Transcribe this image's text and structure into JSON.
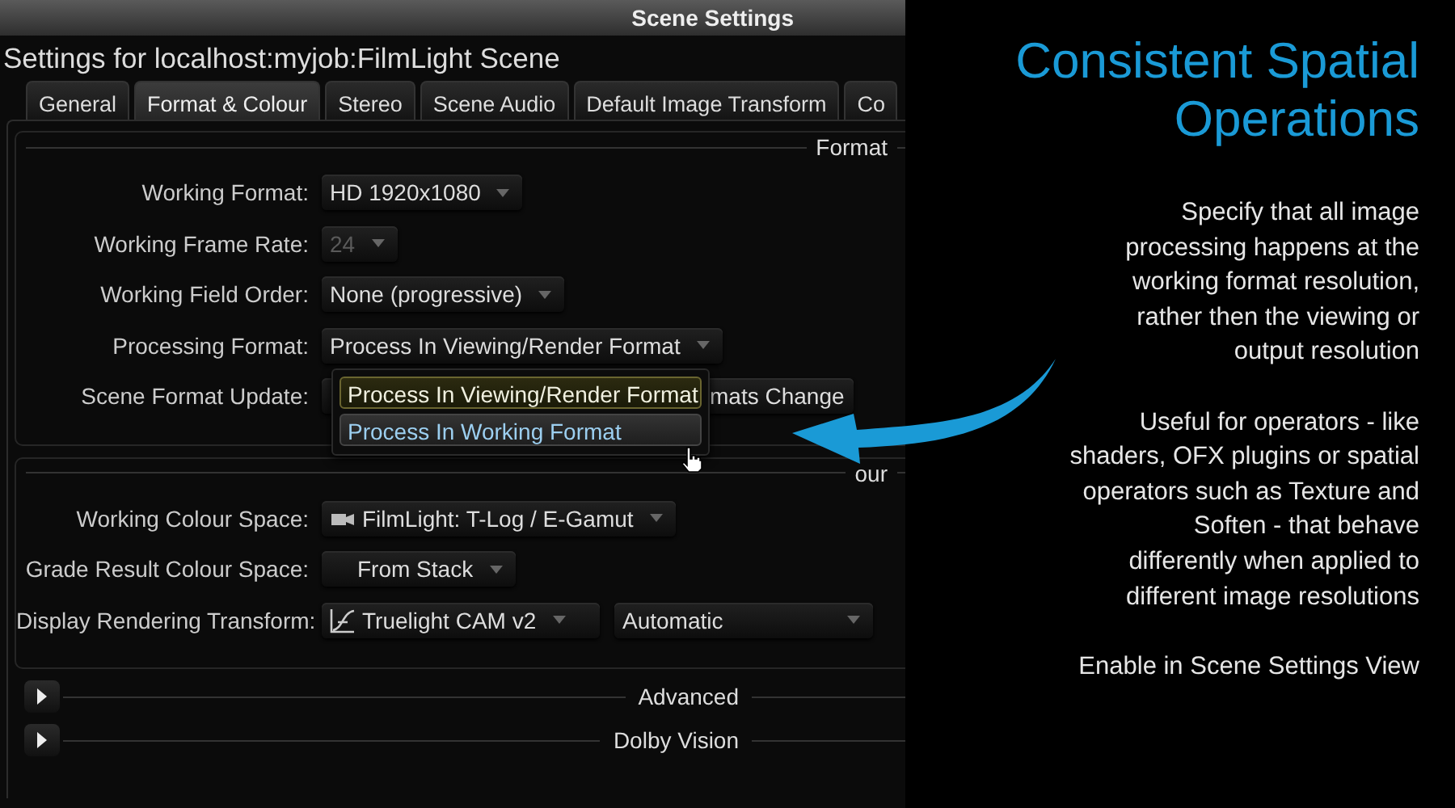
{
  "window": {
    "title": "Scene Settings"
  },
  "heading": "Settings for localhost:myjob:FilmLight Scene",
  "tabs": [
    {
      "label": "General",
      "selected": false
    },
    {
      "label": "Format & Colour",
      "selected": true
    },
    {
      "label": "Stereo",
      "selected": false
    },
    {
      "label": "Scene Audio",
      "selected": false
    },
    {
      "label": "Default Image Transform",
      "selected": false
    },
    {
      "label": "Co",
      "selected": false
    }
  ],
  "sections": [
    {
      "title": "Format",
      "rows": [
        {
          "label": "Working Format:",
          "fields": [
            {
              "kind": "dropdown",
              "value": "HD 1920x1080",
              "disabled": false
            }
          ]
        },
        {
          "label": "Working Frame Rate:",
          "fields": [
            {
              "kind": "dropdown",
              "value": "24",
              "disabled": true
            }
          ]
        },
        {
          "label": "Working Field Order:",
          "fields": [
            {
              "kind": "dropdown",
              "value": "None (progressive)",
              "disabled": false
            }
          ]
        },
        {
          "label": "Processing Format:",
          "fields": [
            {
              "kind": "dropdown",
              "value": "Process In Viewing/Render Format",
              "disabled": false
            }
          ]
        },
        {
          "label": "Scene Format Update:",
          "fields": [
            {
              "kind": "button",
              "value": "mats Change",
              "disabled": false
            }
          ]
        }
      ]
    },
    {
      "title": "our",
      "rows": [
        {
          "label": "Working Colour Space:",
          "fields": [
            {
              "kind": "colourspace",
              "value": "FilmLight: T-Log / E-Gamut",
              "disabled": false
            }
          ]
        },
        {
          "label": "Grade Result Colour Space:",
          "fields": [
            {
              "kind": "blank",
              "value": "From Stack",
              "disabled": false
            }
          ]
        },
        {
          "label": "Display Rendering Transform:",
          "fields": [
            {
              "kind": "transform",
              "value": "Truelight CAM v2",
              "disabled": false
            },
            {
              "kind": "wide",
              "value": "Automatic",
              "disabled": false
            }
          ]
        }
      ]
    }
  ],
  "collapsible_sections": [
    {
      "title": "Advanced",
      "expanded": false
    },
    {
      "title": "Dolby Vision",
      "expanded": false
    }
  ],
  "popup_menu": [
    {
      "label": "Process In Viewing/Render Format",
      "selected": true,
      "hovered": false
    },
    {
      "label": "Process In Working Format",
      "selected": false,
      "hovered": true
    }
  ],
  "callout": {
    "title": "Consistent Spatial\nOperations",
    "paragraphs": [
      "Specify that all image\nprocessing happens at the\nworking format resolution,\nrather then the viewing or\noutput resolution",
      "Useful for operators - like\nshaders, OFX plugins or spatial\noperators such as Texture and\nSoften - that behave\ndifferently when applied to\ndifferent image resolutions",
      "Enable in Scene Settings View"
    ]
  }
}
